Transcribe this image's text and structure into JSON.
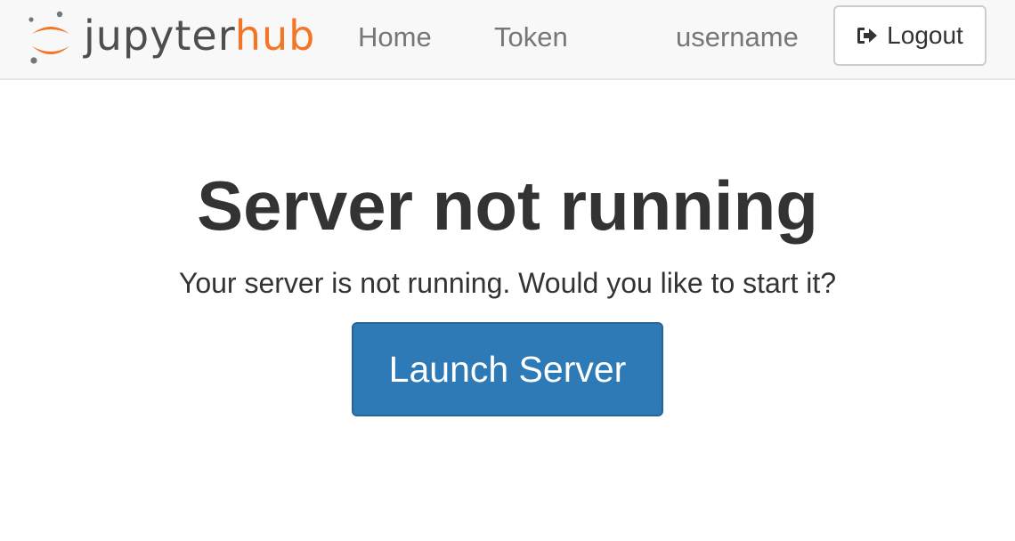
{
  "navbar": {
    "logo": {
      "text_primary": "jupyter",
      "text_accent": "hub",
      "icon": "jupyter-logo-icon",
      "colors": {
        "primary": "#4e4e4e",
        "accent": "#f37626",
        "dots": "#767677"
      }
    },
    "links": {
      "home": "Home",
      "token": "Token"
    },
    "user": {
      "name": "username"
    },
    "logout": {
      "label": "Logout",
      "icon": "sign-out-icon"
    }
  },
  "main": {
    "title": "Server not running",
    "message": "Your server is not running. Would you like to start it?",
    "launch_button": {
      "label": "Launch Server",
      "color": "#2e7ab6"
    }
  }
}
